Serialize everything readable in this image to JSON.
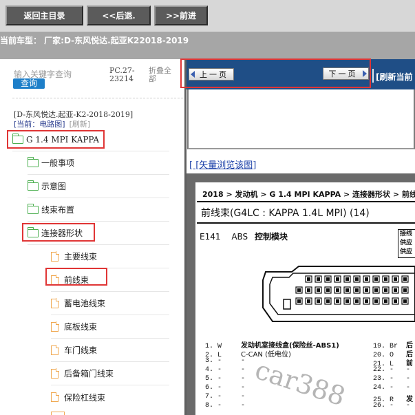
{
  "toolbar": {
    "back_home": "返回主目录",
    "back": "<<后退.",
    "forward": ">>前进"
  },
  "current_car": "当前车型：   厂家:D-东风悦达.起亚K22018-2019",
  "left": {
    "search_placeholder": "输入关键字查询",
    "search_button": "查询",
    "pc_code": "PC.27-23214",
    "collapse_all": "折叠全部",
    "path": "[D-东风悦达.起亚-K2-2018-2019]",
    "current_label": "[当前：电路图]",
    "refresh": "[刷新]",
    "tree": [
      {
        "label": "G 1.4 MPI KAPPA",
        "icon": "folder-icon"
      },
      {
        "label": "一般事项",
        "icon": "folder-icon"
      },
      {
        "label": "示意图",
        "icon": "folder-icon"
      },
      {
        "label": "线束布置",
        "icon": "folder-icon"
      },
      {
        "label": "连接器形状",
        "icon": "folder-icon"
      },
      {
        "label": "主要线束",
        "icon": "document-icon"
      },
      {
        "label": "前线束",
        "icon": "document-icon"
      },
      {
        "label": "蓄电池线束",
        "icon": "document-icon"
      },
      {
        "label": "底板线束",
        "icon": "document-icon"
      },
      {
        "label": "车门线束",
        "icon": "document-icon"
      },
      {
        "label": "后备箱门线束",
        "icon": "document-icon"
      },
      {
        "label": "保险杠线束",
        "icon": "document-icon"
      }
    ]
  },
  "right": {
    "prev_page": "上一页",
    "next_page": "下一页",
    "refresh_current": "[刷新当前",
    "vector_link": "[ [矢量浏览该图]",
    "doc": {
      "breadcrumb": "2018 > 发动机 > G 1.4 MPI KAPPA > 连接器形状 > 前线",
      "title": "前线束(G4LC : KAPPA 1.4L MPI) (14)",
      "connector_code": "E141",
      "connector_type": "ABS",
      "connector_name": "控制模块",
      "legend": [
        "接线",
        "供应",
        "供应"
      ],
      "pins_left": [
        {
          "no": "1. W",
          "name": "发动机室接线盒(保险丝-ABS1)"
        },
        {
          "no": "2. L",
          "name": "C-CAN (低电位)"
        },
        {
          "no": "3. -",
          "name": "-"
        },
        {
          "no": "4. -",
          "name": "-"
        },
        {
          "no": "5. -",
          "name": "-"
        },
        {
          "no": "6. -",
          "name": "-"
        },
        {
          "no": "7. -",
          "name": "-"
        },
        {
          "no": "8. -",
          "name": "-"
        }
      ],
      "pins_right": [
        {
          "no": "19. Br",
          "name": "后"
        },
        {
          "no": "20. O",
          "name": "后"
        },
        {
          "no": "21. L",
          "name": "前"
        },
        {
          "no": "22. -",
          "name": "-"
        },
        {
          "no": "23. -",
          "name": "-"
        },
        {
          "no": "24. -",
          "name": "-"
        },
        {
          "no": "25. R",
          "name": "发"
        },
        {
          "no": "26. -",
          "name": "-"
        }
      ],
      "watermark": "car388"
    }
  },
  "colors": {
    "toolbar_btn": "#5b5b5b",
    "nav_header": "#1f4e86",
    "highlight_border": "#e03535",
    "folder_icon": "#4caf50",
    "doc_icon": "#f0a850",
    "link": "#1a3fa8"
  }
}
